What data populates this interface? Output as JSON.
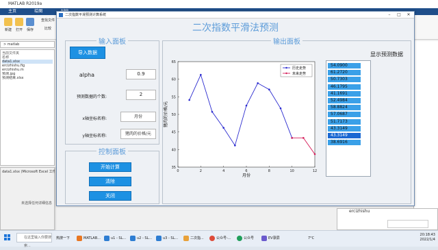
{
  "matlab": {
    "title": "MATLAB R2019a",
    "tabs": [
      "主页",
      "绘图",
      "APP"
    ],
    "ribbon": [
      "新建",
      "打开",
      "保存",
      "查找文件",
      "比较",
      "导入数据"
    ],
    "path": "> matlab",
    "files_header": "当前文件夹",
    "files_name_col": "名称",
    "files": [
      "data1.xlsx",
      "ercizhishu.fig",
      "ercizhishu.m",
      "预测.jpg",
      "预测结果.xlsx"
    ],
    "detail_title": "data1.xlsx  (Microsoft Excel 工作表)",
    "detail_hint": "未选择任何详细信息",
    "cmd_label": "ercizhishu"
  },
  "gui": {
    "window_title": "二次指数平滑预测计算系统",
    "heading": "二次指数平滑法预测",
    "input_panel_title": "输入面板",
    "output_panel_title": "输出面板",
    "control_panel_title": "控制面板",
    "import_button": "导入数据",
    "alpha_label": "alpha",
    "alpha_value": "0.9",
    "count_label": "预测数据的个数:",
    "count_value": "2",
    "xlabel_label": "x轴坐标名称:",
    "xlabel_value": "月份",
    "ylabel_label": "y轴坐标名称:",
    "ylabel_value": "猪肉的价格/元",
    "start_button": "开始计算",
    "clear_button": "清除",
    "close_button": "关闭",
    "list_title": "显示预测数据",
    "list_values": [
      "54.0900",
      "61.2720",
      "50.7303",
      "46.1795",
      "41.1691",
      "52.4984",
      "58.8824",
      "57.0687",
      "51.7173",
      "43.3149",
      "43.3149",
      "38.6916"
    ],
    "selected_index": 10,
    "highlight_color": "#3aa0e8",
    "selected_color": "#1967d2"
  },
  "chart_data": {
    "type": "line",
    "xlabel": "月份",
    "ylabel": "猪肉的价格/元",
    "xlim": [
      0,
      12
    ],
    "ylim": [
      35,
      65
    ],
    "xticks": [
      0,
      2,
      4,
      6,
      8,
      10,
      12
    ],
    "yticks": [
      35,
      40,
      45,
      50,
      55,
      60,
      65
    ],
    "legend_position": "top-right",
    "series": [
      {
        "name": "历史走势",
        "color": "#2a2acf",
        "x": [
          1,
          2,
          3,
          4,
          5,
          6,
          7,
          8,
          9,
          10
        ],
        "y": [
          54.09,
          61.27,
          50.73,
          46.18,
          41.17,
          52.5,
          58.88,
          57.07,
          51.72,
          43.31
        ]
      },
      {
        "name": "未来走势",
        "color": "#d61f5b",
        "x": [
          10,
          11,
          12
        ],
        "y": [
          43.31,
          43.31,
          38.69
        ]
      }
    ]
  },
  "taskbar": {
    "search_placeholder": "在这里输入你要搜索...",
    "items": [
      "热搜一下",
      "MATLAB...",
      "u1 - SL...",
      "u2 - SL...",
      "u3 - SL...",
      "二次指...",
      "公众号-...",
      "公众号",
      "EV录屏"
    ],
    "temperature": "7°C",
    "time": "20:18:43",
    "date": "2022/1/4"
  }
}
